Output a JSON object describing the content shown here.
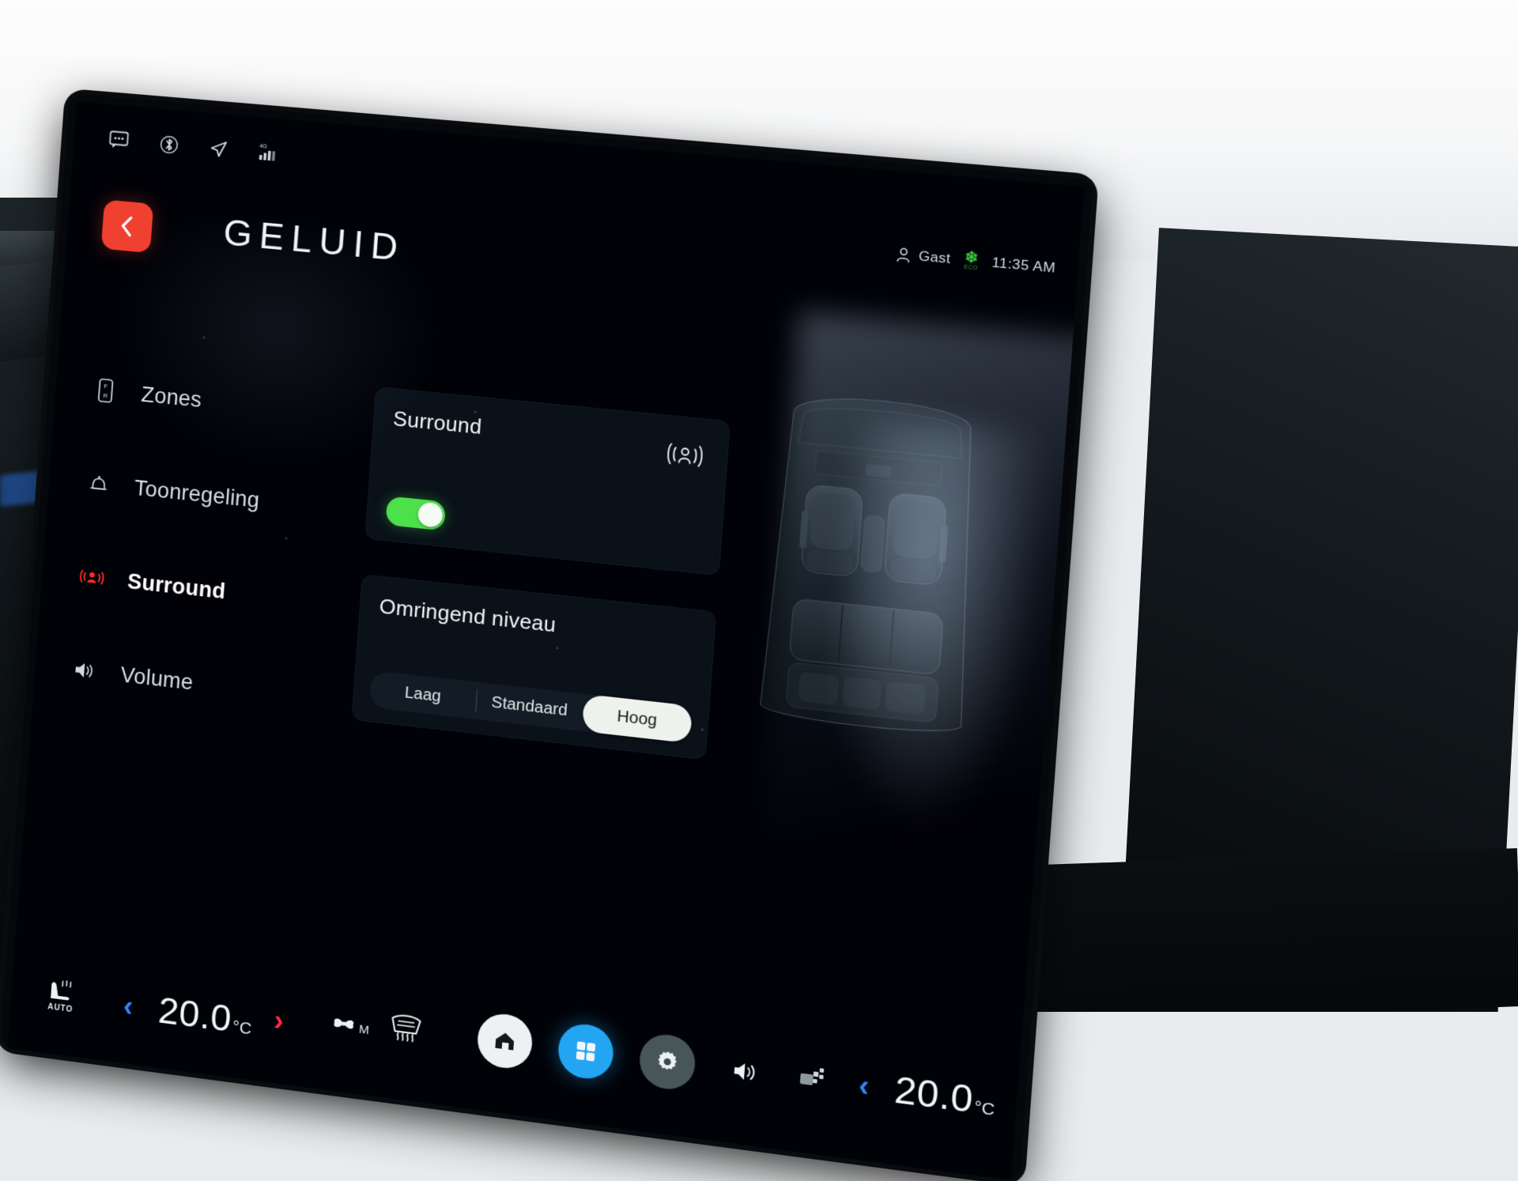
{
  "statusbar": {
    "icons": [
      "message-icon",
      "bluetooth-icon",
      "navigation-icon",
      "signal-4g-icon"
    ],
    "network_label": "4G",
    "user_label": "Gast",
    "eco_label": "ECO",
    "time": "11:35 AM"
  },
  "header": {
    "back_icon": "chevron-left-icon",
    "title": "GELUID"
  },
  "sidebar": {
    "items": [
      {
        "label": "Zones",
        "icon": "fader-icon",
        "active": false
      },
      {
        "label": "Toonregeling",
        "icon": "bell-icon",
        "active": false
      },
      {
        "label": "Surround",
        "icon": "surround-icon",
        "active": true
      },
      {
        "label": "Volume",
        "icon": "speaker-icon",
        "active": false
      }
    ]
  },
  "cards": {
    "surround": {
      "title": "Surround",
      "icon": "surround-person-icon",
      "toggle_state": "on"
    },
    "level": {
      "title": "Omringend niveau",
      "options": [
        "Laag",
        "Standaard",
        "Hoog"
      ],
      "selected": "Hoog"
    }
  },
  "seatmap": {
    "name": "vehicle-interior-topdown"
  },
  "bottombar": {
    "left_seat_icon": "heated-seat-auto-icon",
    "left_seat_label": "AUTO",
    "left_temp": "20.0",
    "left_temp_unit": "°C",
    "fan_icon": "fan-icon",
    "fan_mode": "M",
    "defrost_icon": "windshield-defrost-icon",
    "home_icon": "home-icon",
    "apps_icon": "apps-grid-icon",
    "settings_icon": "gear-icon",
    "volume_icon": "volume-icon",
    "rear_defrost_icon": "rear-defrost-icon",
    "right_temp": "20.0",
    "right_temp_unit": "°C",
    "right_seat_icon": "seat-icon",
    "chevron_left": "‹",
    "chevron_right": "›"
  },
  "colors": {
    "accent_red": "#ef4030",
    "toggle_green": "#4ce04a",
    "apps_blue": "#22a5f2",
    "cold_blue": "#2f86ff",
    "hot_red": "#ff2a42",
    "card_bg": "#0a1119",
    "screen_bg": "#000207"
  }
}
